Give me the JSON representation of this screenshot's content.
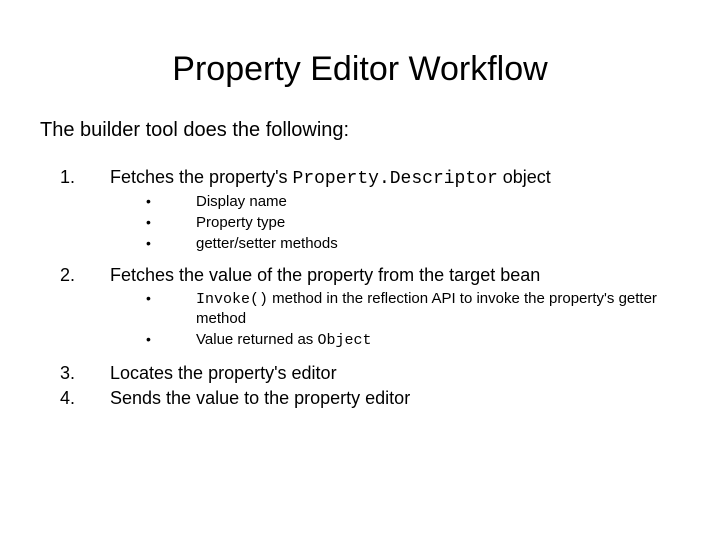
{
  "title": "Property Editor Workflow",
  "intro": "The builder tool does the following:",
  "steps": {
    "s1": {
      "num": "1.",
      "text_a": "Fetches the property's ",
      "code": "Property.Descriptor",
      "text_b": " object",
      "sub": {
        "a": "Display name",
        "b": "Property type",
        "c": "getter/setter methods"
      }
    },
    "s2": {
      "num": "2.",
      "text": "Fetches the value of the property from the target bean",
      "sub": {
        "a_code": "Invoke()",
        "a_rest": " method in the reflection API to invoke the property's getter method",
        "b_pre": "Value returned as ",
        "b_code": "Object"
      }
    },
    "s3": {
      "num": "3.",
      "text": "Locates the property's editor"
    },
    "s4": {
      "num": "4.",
      "text": "Sends the value to the property editor"
    }
  },
  "bullet": "•"
}
